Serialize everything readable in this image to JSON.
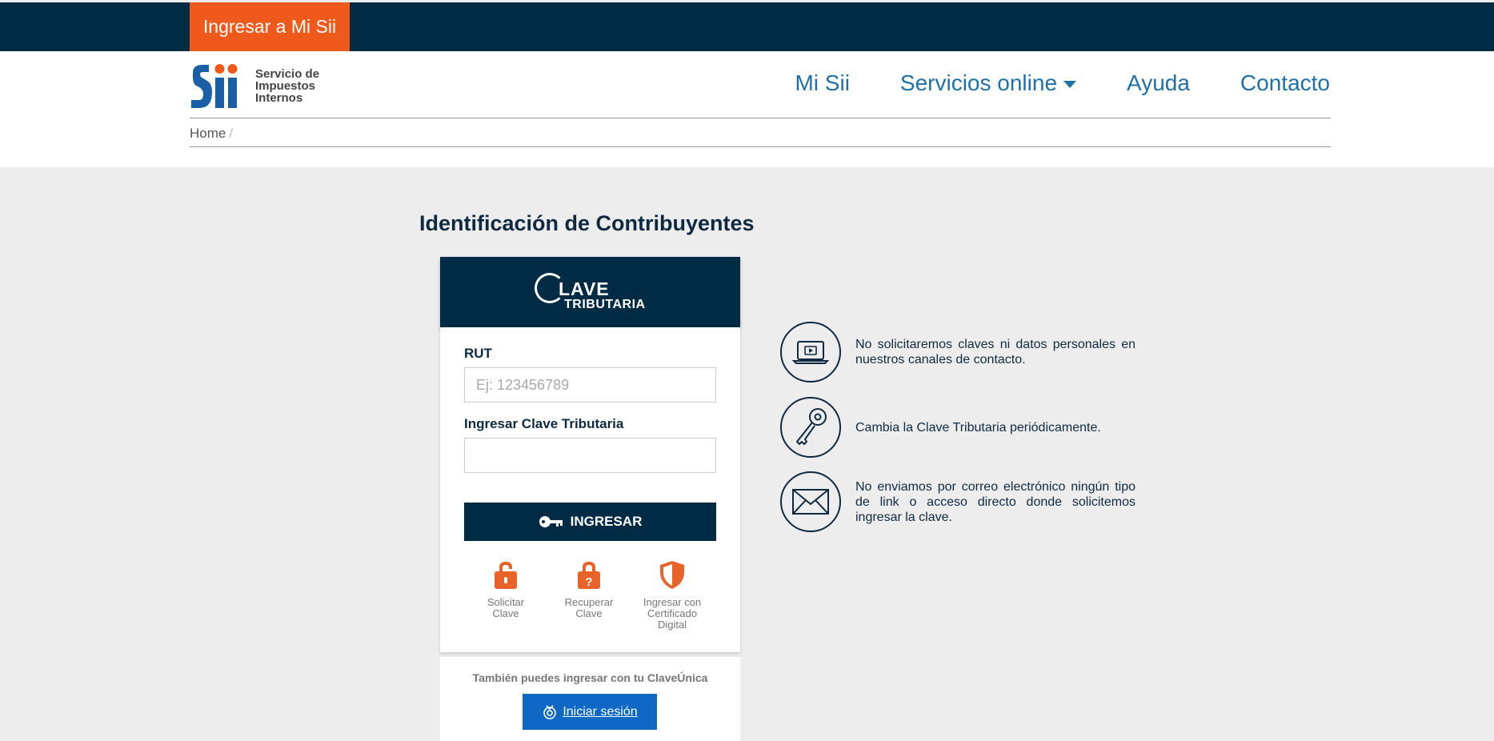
{
  "topbar": {
    "login_link": "Ingresar a Mi Sii"
  },
  "logo": {
    "text_line1": "Servicio de",
    "text_line2": "Impuestos",
    "text_line3": "Internos"
  },
  "nav": {
    "items": [
      "Mi Sii",
      "Servicios online",
      "Ayuda",
      "Contacto"
    ]
  },
  "breadcrumb": {
    "home": "Home",
    "separator": "/"
  },
  "page_title": "Identificación de Contribuyentes",
  "card": {
    "logo_word": "LAVE",
    "logo_sub": "TRIBUTARIA",
    "rut_label": "RUT",
    "rut_placeholder": "Ej: 123456789",
    "rut_value": "",
    "clave_label": "Ingresar Clave Tributaria",
    "clave_value": "",
    "submit_label": "INGRESAR",
    "options": [
      {
        "line1": "Solicitar",
        "line2": "Clave",
        "line3": ""
      },
      {
        "line1": "Recuperar",
        "line2": "Clave",
        "line3": ""
      },
      {
        "line1": "Ingresar con",
        "line2": "Certificado",
        "line3": "Digital"
      }
    ]
  },
  "claveunica": {
    "text": "También puedes ingresar con tu ClaveÚnica",
    "button_label": "Iniciar sesión"
  },
  "tips": [
    "No solicitaremos claves ni datos personales en nuestros canales de contacto.",
    "Cambia la Clave Tributaria periódicamente.",
    "No enviamos por correo electrónico ningún tipo de link o acceso directo donde solicitemos ingresar la clave."
  ],
  "colors": {
    "navy": "#002b45",
    "orange": "#ef5a1c",
    "link_blue": "#1f6fa8",
    "claveunica_blue": "#0f69c4",
    "icon_orange": "#e8632a"
  }
}
